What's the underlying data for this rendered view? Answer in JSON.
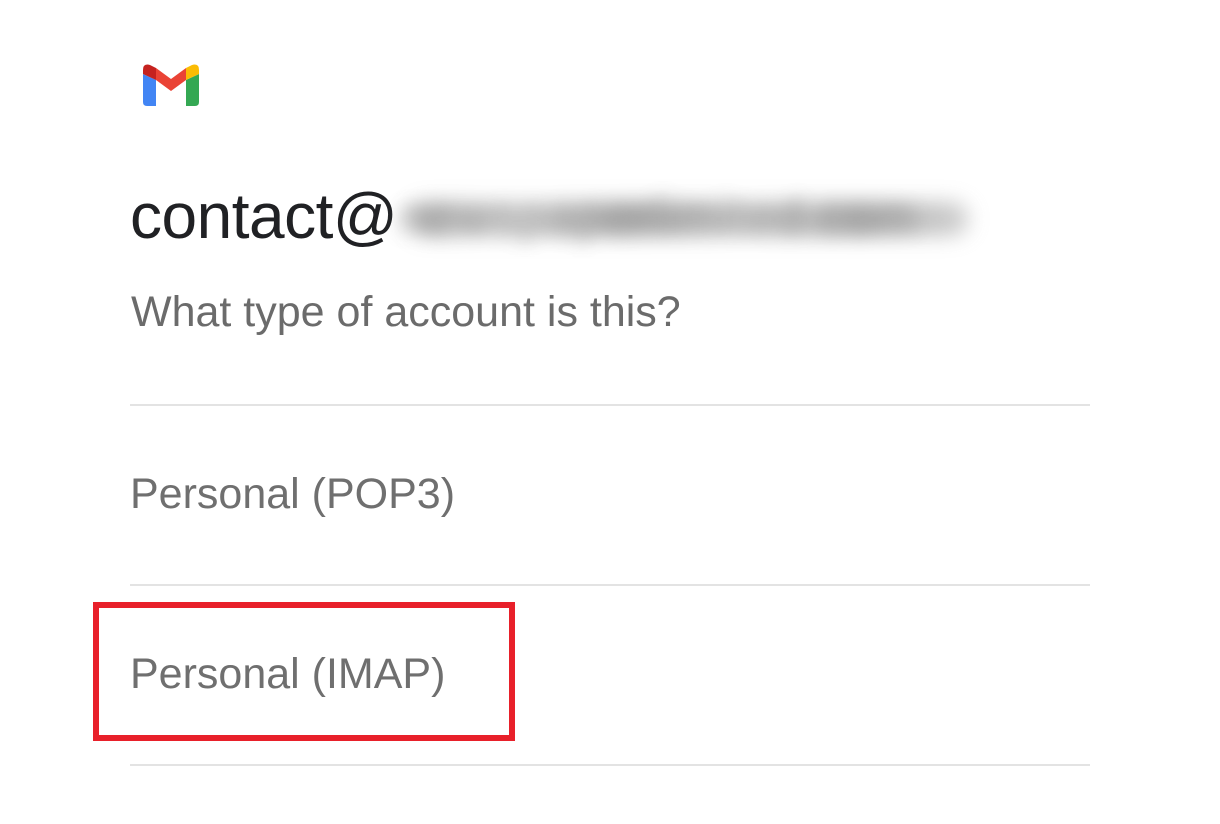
{
  "header": {
    "logo_icon": "gmail-logo-icon"
  },
  "account": {
    "email_prefix": "contact@",
    "email_domain_redacted": "newspaperlimited.com"
  },
  "prompt": {
    "question": "What type of account is this?"
  },
  "options": [
    {
      "label": "Personal (POP3)",
      "highlighted": false
    },
    {
      "label": "Personal (IMAP)",
      "highlighted": true
    }
  ],
  "colors": {
    "highlight": "#e8202a",
    "gmail_red": "#ea4335",
    "gmail_blue": "#4285f4",
    "gmail_green": "#34a853",
    "gmail_yellow": "#fbbc04",
    "gmail_dark_red": "#c5221f"
  }
}
